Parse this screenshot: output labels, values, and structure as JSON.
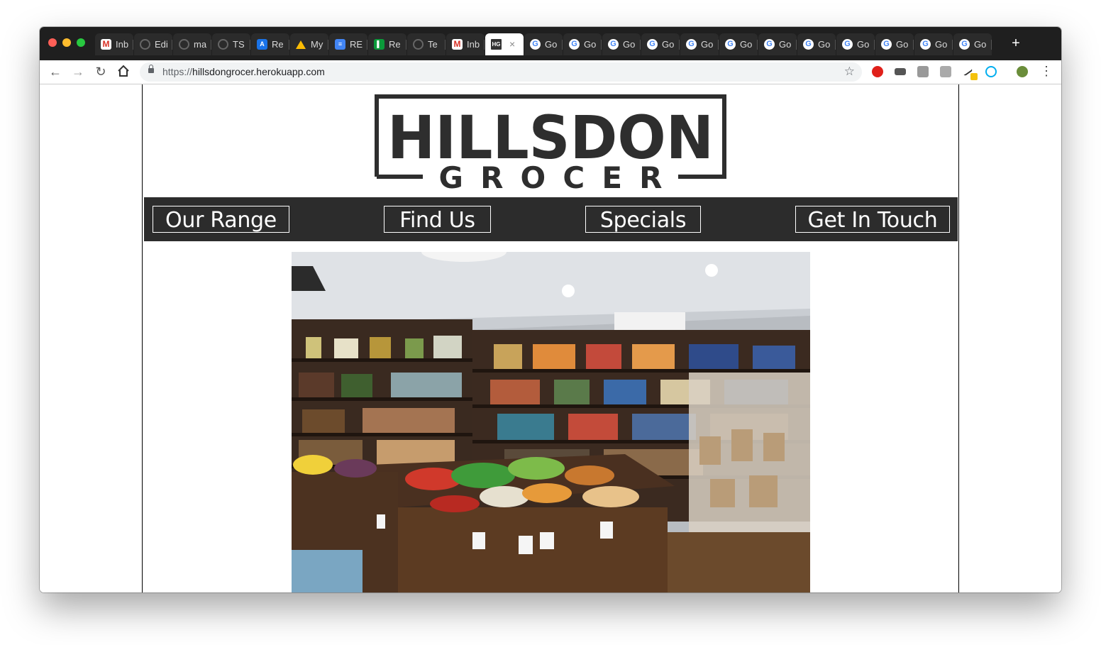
{
  "browser": {
    "tabs": [
      {
        "icon": "gmail-icon",
        "label": "Inb"
      },
      {
        "icon": "github-icon",
        "label": "Edi"
      },
      {
        "icon": "github-icon",
        "label": "ma"
      },
      {
        "icon": "github-icon",
        "label": "TS"
      },
      {
        "icon": "atlassian-icon",
        "label": "Re"
      },
      {
        "icon": "google-drive-icon",
        "label": "My"
      },
      {
        "icon": "google-docs-icon",
        "label": "RE"
      },
      {
        "icon": "trello-icon",
        "label": "Re"
      },
      {
        "icon": "github-icon",
        "label": "Te"
      },
      {
        "icon": "gmail-icon",
        "label": "Inb"
      },
      {
        "icon": "hg-icon",
        "label": "",
        "active": true
      },
      {
        "icon": "google-icon",
        "label": "Go"
      },
      {
        "icon": "google-icon",
        "label": "Go"
      },
      {
        "icon": "google-icon",
        "label": "Go"
      },
      {
        "icon": "google-icon",
        "label": "Go"
      },
      {
        "icon": "google-icon",
        "label": "Go"
      },
      {
        "icon": "google-icon",
        "label": "Go"
      },
      {
        "icon": "google-icon",
        "label": "Go"
      },
      {
        "icon": "google-icon",
        "label": "Go"
      },
      {
        "icon": "google-icon",
        "label": "Go"
      },
      {
        "icon": "google-icon",
        "label": "Go"
      },
      {
        "icon": "google-icon",
        "label": "Go"
      },
      {
        "icon": "google-icon",
        "label": "Go"
      }
    ],
    "active_tab_favicon": "HG",
    "url_scheme": "https://",
    "url_host": "hillsdongrocer.herokuapp.com"
  },
  "site": {
    "logo": {
      "title": "HILLSDON",
      "subtitle": "GROCER"
    },
    "nav": [
      {
        "label": "Our Range"
      },
      {
        "label": "Find Us"
      },
      {
        "label": "Specials"
      },
      {
        "label": "Get In Touch"
      }
    ],
    "hero_alt": "store interior"
  },
  "colors": {
    "navbar_bg": "#2c2c2c",
    "logo_dark": "#2e2e2e",
    "tabstrip_bg": "#1f1f1f"
  }
}
